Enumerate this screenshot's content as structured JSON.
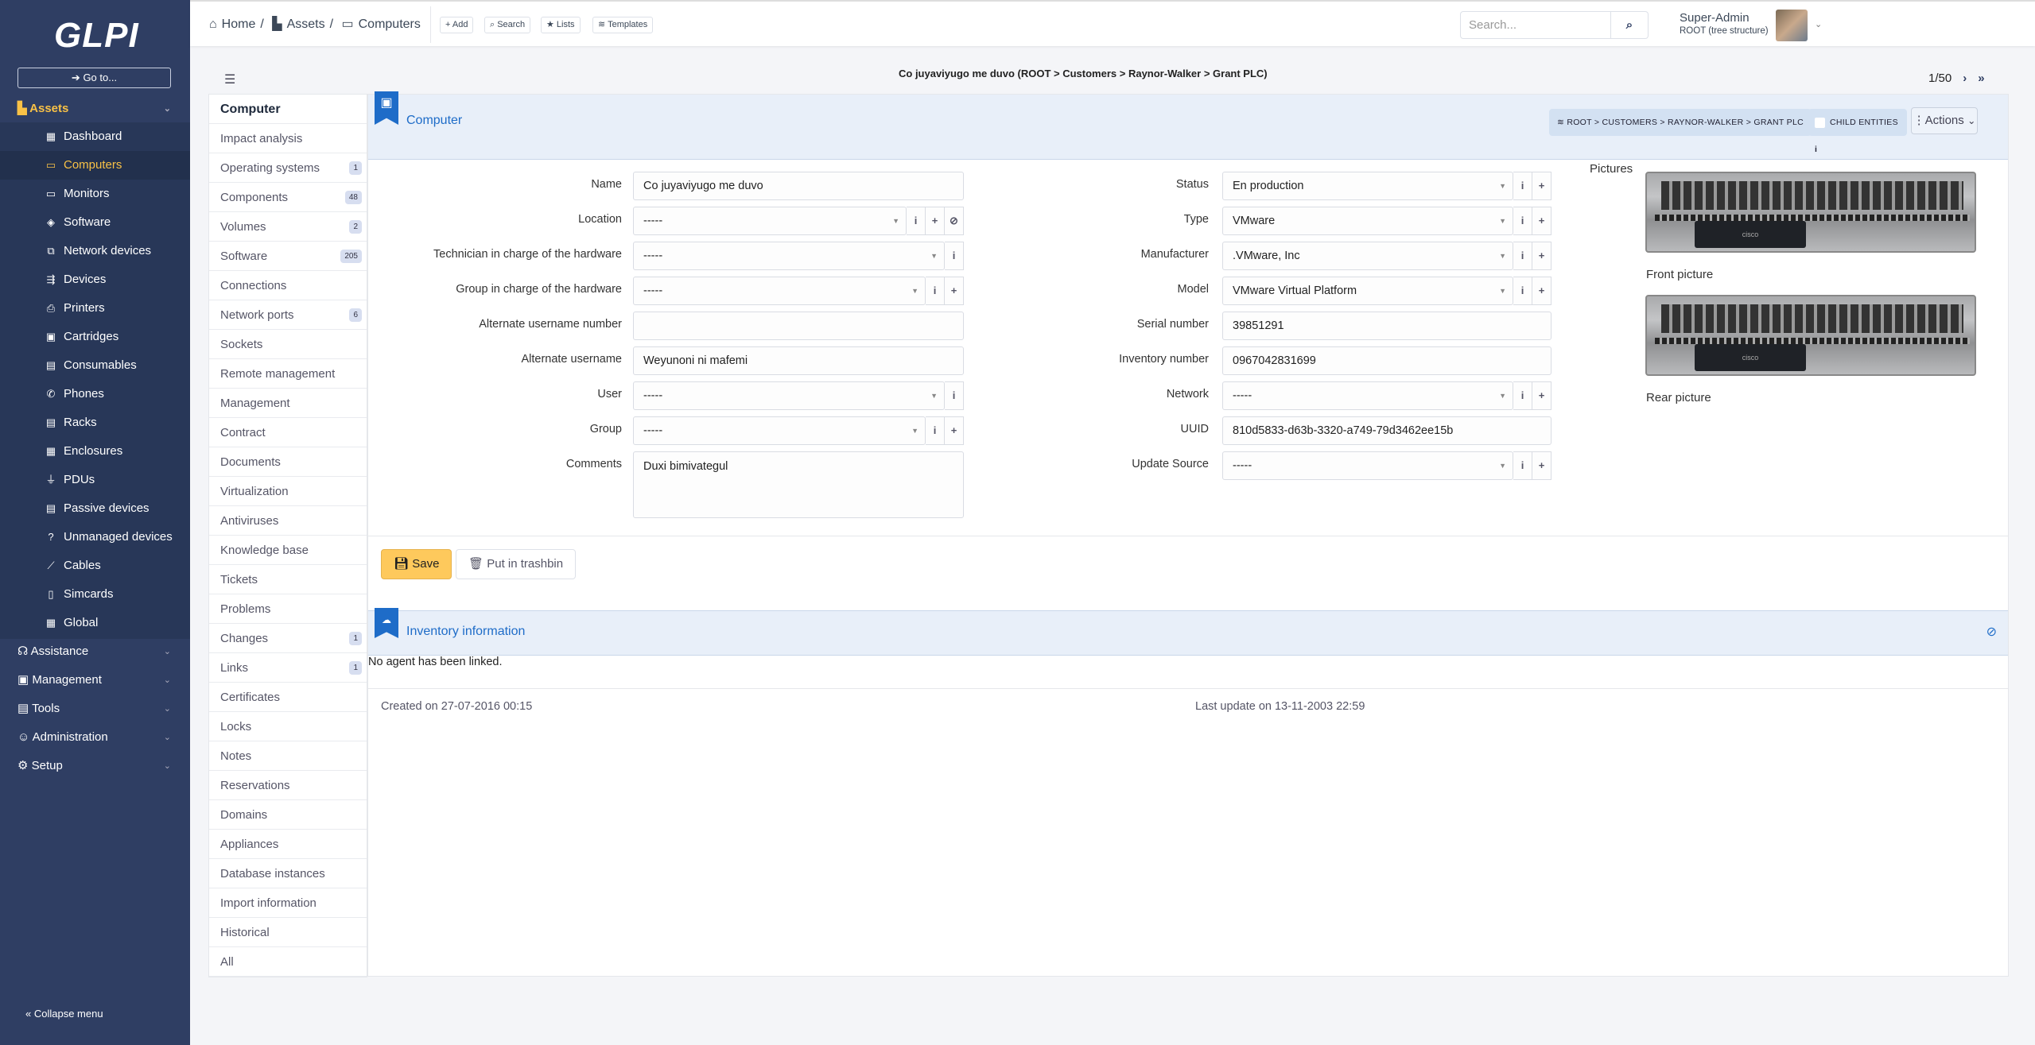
{
  "app": {
    "logo": "GLPI",
    "goto": "Go to...",
    "collapse": "Collapse menu"
  },
  "sidebar": {
    "assets": "Assets",
    "items": [
      {
        "label": "Dashboard",
        "icon": "dashboard-icon",
        "glyph": "▦"
      },
      {
        "label": "Computers",
        "icon": "laptop-icon",
        "glyph": "▭",
        "active": true
      },
      {
        "label": "Monitors",
        "icon": "monitor-icon",
        "glyph": "▭"
      },
      {
        "label": "Software",
        "icon": "box-icon",
        "glyph": "◈"
      },
      {
        "label": "Network devices",
        "icon": "network-icon",
        "glyph": "⧉"
      },
      {
        "label": "Devices",
        "icon": "usb-icon",
        "glyph": "⇶"
      },
      {
        "label": "Printers",
        "icon": "printer-icon",
        "glyph": "⎙"
      },
      {
        "label": "Cartridges",
        "icon": "cartridge-icon",
        "glyph": "▣"
      },
      {
        "label": "Consumables",
        "icon": "consumables-icon",
        "glyph": "▤"
      },
      {
        "label": "Phones",
        "icon": "phone-icon",
        "glyph": "✆"
      },
      {
        "label": "Racks",
        "icon": "rack-icon",
        "glyph": "▤"
      },
      {
        "label": "Enclosures",
        "icon": "enclosure-icon",
        "glyph": "▦"
      },
      {
        "label": "PDUs",
        "icon": "plug-icon",
        "glyph": "⏚"
      },
      {
        "label": "Passive devices",
        "icon": "passive-device-icon",
        "glyph": "▤"
      },
      {
        "label": "Unmanaged devices",
        "icon": "question-icon",
        "glyph": "?"
      },
      {
        "label": "Cables",
        "icon": "cable-icon",
        "glyph": "⟋"
      },
      {
        "label": "Simcards",
        "icon": "simcard-icon",
        "glyph": "▯"
      },
      {
        "label": "Global",
        "icon": "global-icon",
        "glyph": "▦"
      }
    ],
    "sections": [
      {
        "label": "Assistance",
        "icon": "headset-icon",
        "glyph": "☊"
      },
      {
        "label": "Management",
        "icon": "wallet-icon",
        "glyph": "▣"
      },
      {
        "label": "Tools",
        "icon": "briefcase-icon",
        "glyph": "▤"
      },
      {
        "label": "Administration",
        "icon": "users-icon",
        "glyph": "☺"
      },
      {
        "label": "Setup",
        "icon": "cogs-icon",
        "glyph": "⚙"
      }
    ]
  },
  "header": {
    "breadcrumb": [
      "Home",
      "Assets",
      "Computers"
    ],
    "buttons": [
      "Add",
      "Search",
      "Lists",
      "Templates"
    ],
    "search_placeholder": "Search...",
    "user_name": "Super-Admin",
    "user_entity": "ROOT (tree structure)"
  },
  "record": {
    "title": "Co juyaviyugo me duvo (ROOT > Customers > Raynor-Walker > Grant PLC)",
    "pager": "1/50"
  },
  "tabs": [
    {
      "label": "Computer",
      "active": true
    },
    {
      "label": "Impact analysis"
    },
    {
      "label": "Operating systems",
      "count": "1"
    },
    {
      "label": "Components",
      "count": "48"
    },
    {
      "label": "Volumes",
      "count": "2"
    },
    {
      "label": "Software",
      "count": "205"
    },
    {
      "label": "Connections"
    },
    {
      "label": "Network ports",
      "count": "6"
    },
    {
      "label": "Sockets"
    },
    {
      "label": "Remote management"
    },
    {
      "label": "Management"
    },
    {
      "label": "Contract"
    },
    {
      "label": "Documents"
    },
    {
      "label": "Virtualization"
    },
    {
      "label": "Antiviruses"
    },
    {
      "label": "Knowledge base"
    },
    {
      "label": "Tickets"
    },
    {
      "label": "Problems"
    },
    {
      "label": "Changes",
      "count": "1"
    },
    {
      "label": "Links",
      "count": "1"
    },
    {
      "label": "Certificates"
    },
    {
      "label": "Locks"
    },
    {
      "label": "Notes"
    },
    {
      "label": "Reservations"
    },
    {
      "label": "Domains"
    },
    {
      "label": "Appliances"
    },
    {
      "label": "Database instances"
    },
    {
      "label": "Import information"
    },
    {
      "label": "Historical"
    },
    {
      "label": "All"
    }
  ],
  "form": {
    "section_title": "Computer",
    "entity_path": "ROOT > CUSTOMERS > RAYNOR-WALKER > GRANT PLC",
    "child_entities": "CHILD ENTITIES",
    "actions": "Actions",
    "left": [
      {
        "label": "Name",
        "value": "Co juyaviyugo me duvo",
        "type": "text",
        "addons": []
      },
      {
        "label": "Location",
        "value": "-----",
        "type": "select",
        "addons": [
          "i",
          "+",
          "⊘"
        ]
      },
      {
        "label": "Technician in charge of the hardware",
        "value": "-----",
        "type": "select",
        "addons": [
          "i"
        ]
      },
      {
        "label": "Group in charge of the hardware",
        "value": "-----",
        "type": "select",
        "addons": [
          "i",
          "+"
        ]
      },
      {
        "label": "Alternate username number",
        "value": "",
        "type": "text",
        "addons": []
      },
      {
        "label": "Alternate username",
        "value": "Weyunoni ni mafemi",
        "type": "text",
        "addons": []
      },
      {
        "label": "User",
        "value": "-----",
        "type": "select",
        "addons": [
          "i"
        ]
      },
      {
        "label": "Group",
        "value": "-----",
        "type": "select",
        "addons": [
          "i",
          "+"
        ]
      },
      {
        "label": "Comments",
        "value": "Duxi bimivategul",
        "type": "textarea",
        "addons": []
      }
    ],
    "right": [
      {
        "label": "Status",
        "value": "En production",
        "type": "select",
        "addons": [
          "i",
          "+"
        ]
      },
      {
        "label": "Type",
        "value": "VMware",
        "type": "select",
        "addons": [
          "i",
          "+"
        ]
      },
      {
        "label": "Manufacturer",
        "value": ".VMware, Inc",
        "type": "select",
        "addons": [
          "i",
          "+"
        ]
      },
      {
        "label": "Model",
        "value": "VMware Virtual Platform",
        "type": "select",
        "addons": [
          "i",
          "+"
        ]
      },
      {
        "label": "Serial number",
        "value": "39851291",
        "type": "text",
        "addons": []
      },
      {
        "label": "Inventory number",
        "value": "0967042831699",
        "type": "text",
        "addons": []
      },
      {
        "label": "Network",
        "value": "-----",
        "type": "select",
        "addons": [
          "i",
          "+"
        ]
      },
      {
        "label": "UUID",
        "value": "810d5833-d63b-3320-a749-79d3462ee15b",
        "type": "text",
        "addons": []
      },
      {
        "label": "Update Source",
        "value": "-----",
        "type": "select",
        "addons": [
          "i",
          "+"
        ]
      }
    ],
    "pictures": {
      "label": "Pictures",
      "front": "Front picture",
      "rear": "Rear picture",
      "brand": "cisco"
    },
    "save": "Save",
    "trash": "Put in trashbin"
  },
  "inventory": {
    "title": "Inventory information",
    "message": "No agent has been linked."
  },
  "footer": {
    "created": "Created on 27-07-2016 00:15",
    "updated": "Last update on 13-11-2003 22:59"
  },
  "colors": {
    "sidebar": "#2f3e63",
    "accent": "#f8c146",
    "link": "#1e6cc8",
    "save": "#fec95c"
  }
}
